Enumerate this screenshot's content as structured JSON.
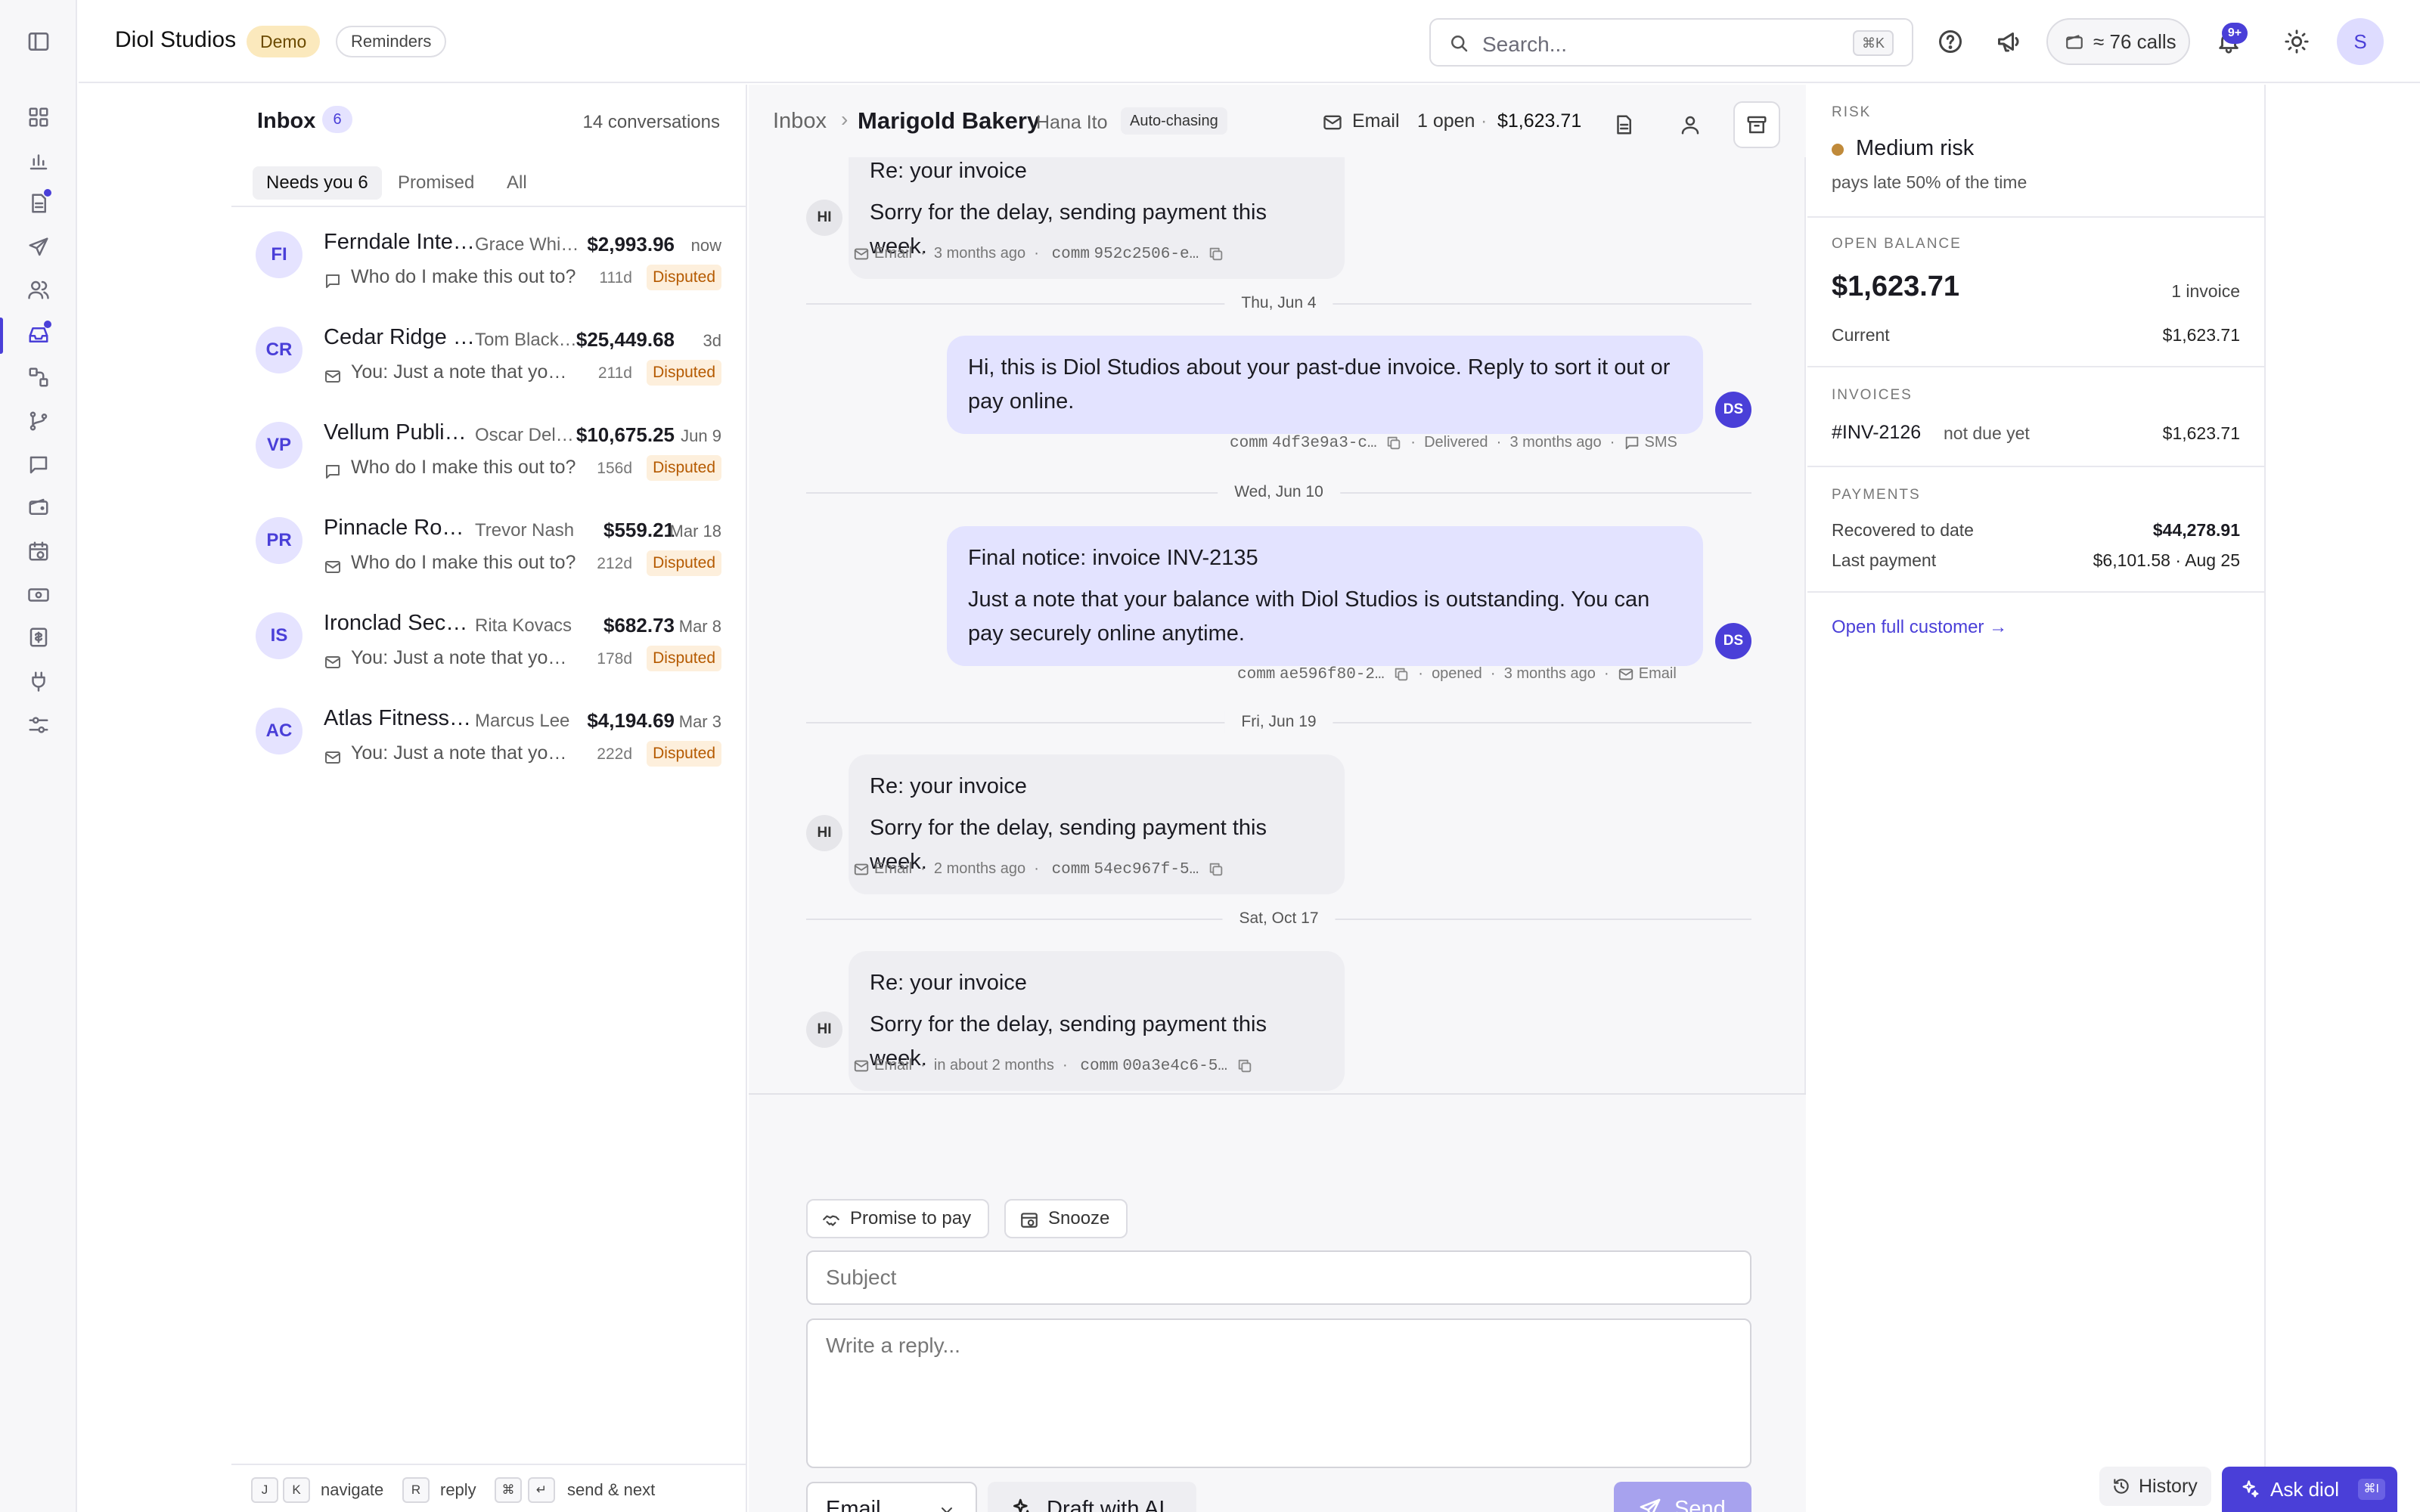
{
  "app": {
    "brand": "Diol Studios",
    "demo_label": "Demo",
    "reminders_label": "Reminders"
  },
  "topbar": {
    "search_placeholder": "Search...",
    "search_shortcut": "⌘K",
    "calls_label": "≈ 76 calls",
    "notifications_badge": "9+",
    "avatar_initial": "S"
  },
  "rail": {
    "items": [
      "dashboard-icon",
      "analytics-icon",
      "invoices-icon",
      "campaigns-icon",
      "customers-icon",
      "inbox-icon",
      "workflows-icon",
      "branches-icon",
      "messages-icon",
      "wallet-icon",
      "schedule-icon",
      "payments-icon",
      "billing-icon",
      "integrations-icon",
      "settings-icon"
    ]
  },
  "inbox": {
    "title": "Inbox",
    "count": "6",
    "conversations_label": "14 conversations",
    "tabs": [
      "Needs you 6",
      "Promised",
      "All"
    ],
    "items": [
      {
        "initials": "FI",
        "name": "Ferndale International",
        "contact": "Grace Whitfield",
        "amount": "$2,993.96",
        "time": "now",
        "snippet": "Who do I make this out to?",
        "age": "111d",
        "status": "Disputed",
        "icon": "chat"
      },
      {
        "initials": "CR",
        "name": "Cedar Ridge Partners",
        "contact": "Tom Blackwood",
        "amount": "$25,449.68",
        "time": "3d",
        "snippet": "You: Just a note that your balance",
        "age": "211d",
        "status": "Disputed",
        "icon": "mail"
      },
      {
        "initials": "VP",
        "name": "Vellum Publishing",
        "contact": "Oscar Delgado",
        "amount": "$10,675.25",
        "time": "Jun 9",
        "snippet": "Who do I make this out to?",
        "age": "156d",
        "status": "Disputed",
        "icon": "chat"
      },
      {
        "initials": "PR",
        "name": "Pinnacle Roofing",
        "contact": "Trevor Nash",
        "amount": "$559.21",
        "time": "Mar 18",
        "snippet": "Who do I make this out to?",
        "age": "212d",
        "status": "Disputed",
        "icon": "mail"
      },
      {
        "initials": "IS",
        "name": "Ironclad Security",
        "contact": "Rita Kovacs",
        "amount": "$682.73",
        "time": "Mar 8",
        "snippet": "You: Just a note that your balance",
        "age": "178d",
        "status": "Disputed",
        "icon": "mail"
      },
      {
        "initials": "AC",
        "name": "Atlas Fitness Co",
        "contact": "Marcus Lee",
        "amount": "$4,194.69",
        "time": "Mar 3",
        "snippet": "You: Just a note that your balance",
        "age": "222d",
        "status": "Disputed",
        "icon": "mail"
      }
    ],
    "hints": {
      "k1": "J",
      "k2": "K",
      "navigate": "navigate",
      "k3": "R",
      "reply": "reply",
      "k4": "⌘",
      "k5": "↵",
      "send_next": "send & next"
    }
  },
  "thread": {
    "crumb_inbox": "Inbox",
    "customer": "Marigold Bakery",
    "contact": "Hana Ito",
    "auto_label": "Auto-chasing",
    "channel": "Email",
    "open_count": "1 open",
    "balance": "$1,623.71",
    "messages": [
      {
        "dir": "in",
        "subject": "Re: your invoice",
        "body": "Sorry for the delay, sending payment this week.",
        "avatar": "HI",
        "meta_channel": "Email",
        "meta_time": "3 months ago",
        "comm": "952c2506-e…"
      },
      {
        "date": "Thu, Jun 4"
      },
      {
        "dir": "out",
        "subject": "",
        "body": "Hi, this is Diol Studios about your past-due invoice. Reply to sort it out or pay online.",
        "avatar": "DS",
        "comm": "4df3e9a3-c…",
        "status": "Delivered",
        "meta_time": "3 months ago",
        "meta_channel": "SMS"
      },
      {
        "date": "Wed, Jun 10"
      },
      {
        "dir": "out",
        "subject": "Final notice: invoice INV-2135",
        "body": "Just a note that your balance with Diol Studios is outstanding. You can pay securely online anytime.",
        "avatar": "DS",
        "comm": "ae596f80-2…",
        "status": "opened",
        "meta_time": "3 months ago",
        "meta_channel": "Email"
      },
      {
        "date": "Fri, Jun 19"
      },
      {
        "dir": "in",
        "subject": "Re: your invoice",
        "body": "Sorry for the delay, sending payment this week.",
        "avatar": "HI",
        "meta_channel": "Email",
        "meta_time": "2 months ago",
        "comm": "54ec967f-5…"
      },
      {
        "date": "Sat, Oct 17"
      },
      {
        "dir": "in",
        "subject": "Re: your invoice",
        "body": "Sorry for the delay, sending payment this week.",
        "avatar": "HI",
        "meta_channel": "Email",
        "meta_time": "in about 2 months",
        "comm": "00a3e4c6-5…"
      }
    ],
    "comm_label": "comm"
  },
  "composer": {
    "promise_label": "Promise to pay",
    "snooze_label": "Snooze",
    "subject_placeholder": "Subject",
    "reply_placeholder": "Write a reply...",
    "channel_value": "Email",
    "draft_label": "Draft with AI",
    "send_label": "Send"
  },
  "panel": {
    "risk_label": "RISK",
    "risk_value": "Medium risk",
    "risk_note": "pays late 50% of the time",
    "risk_color": "#c08a3a",
    "open_balance_label": "OPEN BALANCE",
    "open_balance": "$1,623.71",
    "invoice_count": "1 invoice",
    "current_label": "Current",
    "current_value": "$1,623.71",
    "invoices_label": "INVOICES",
    "invoice_id": "#INV-2126",
    "invoice_status": "not due yet",
    "invoice_amount": "$1,623.71",
    "payments_label": "PAYMENTS",
    "recovered_label": "Recovered to date",
    "recovered_value": "$44,278.91",
    "last_label": "Last payment",
    "last_value": "$6,101.58 · Aug 25",
    "open_customer": "Open full customer →"
  },
  "footer": {
    "history_label": "History",
    "ask_label": "Ask diol",
    "ask_shortcut": "⌘I"
  },
  "colors": {
    "accent": "#4a3fd8",
    "disputed_bg": "#fdefdc",
    "disputed_fg": "#b55a00"
  }
}
